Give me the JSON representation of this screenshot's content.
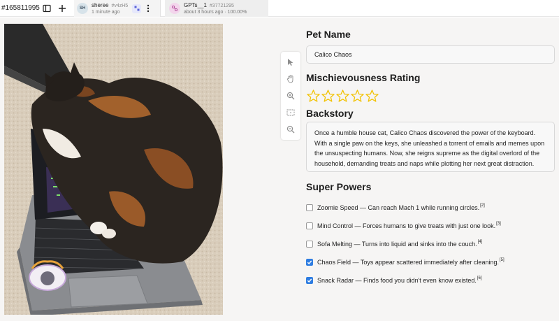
{
  "topbar": {
    "task_id": "#165811995",
    "tab1": {
      "avatar": "SH",
      "user": "sheree",
      "hash": "#v4zH5",
      "time": "1 minute ago"
    },
    "tab2": {
      "title": "GPTs__1",
      "hash": "#37721295",
      "status": "about 3 hours ago · 100.00%"
    },
    "icons": {
      "layout": "sidebar-toggle-icon",
      "add": "plus-icon",
      "more": "kebab-icon"
    }
  },
  "toolbar": [
    "pointer-icon",
    "hand-icon",
    "zoom-in-icon",
    "fit-screen-icon",
    "zoom-out-icon"
  ],
  "form": {
    "pet_name_title": "Pet Name",
    "pet_name_value": "Calico Chaos",
    "rating_title": "Mischievousness Rating",
    "rating": {
      "stars_total": 5,
      "stars_filled": 0,
      "color": "#f2c200"
    },
    "backstory_title": "Backstory",
    "backstory_lines": [
      "Once a humble house cat, Calico Chaos discovered the power of the keyboard.",
      "With a single paw on the keys, she unleashed a torrent of emails and memes upon",
      "the unsuspecting humans. Now, she reigns supreme as the digital overlord of the",
      "household, demanding treats and naps while plotting her next great distraction."
    ],
    "powers_title": "Super Powers",
    "powers": [
      {
        "label": "Zoomie Speed — Can reach Mach 1 while running circles.",
        "ref": "[2]",
        "checked": false
      },
      {
        "label": "Mind Control — Forces humans to give treats with just one look.",
        "ref": "[3]",
        "checked": false
      },
      {
        "label": "Sofa Melting — Turns into liquid and sinks into the couch.",
        "ref": "[4]",
        "checked": false
      },
      {
        "label": "Chaos Field — Toys appear scattered immediately after cleaning.",
        "ref": "[5]",
        "checked": true
      },
      {
        "label": "Snack Radar — Finds food you didn't even know existed.",
        "ref": "[6]",
        "checked": true
      }
    ]
  },
  "colors": {
    "accent": "#2f7de1",
    "star": "#f2c200",
    "canvas_bg": "#f6f5f4"
  }
}
